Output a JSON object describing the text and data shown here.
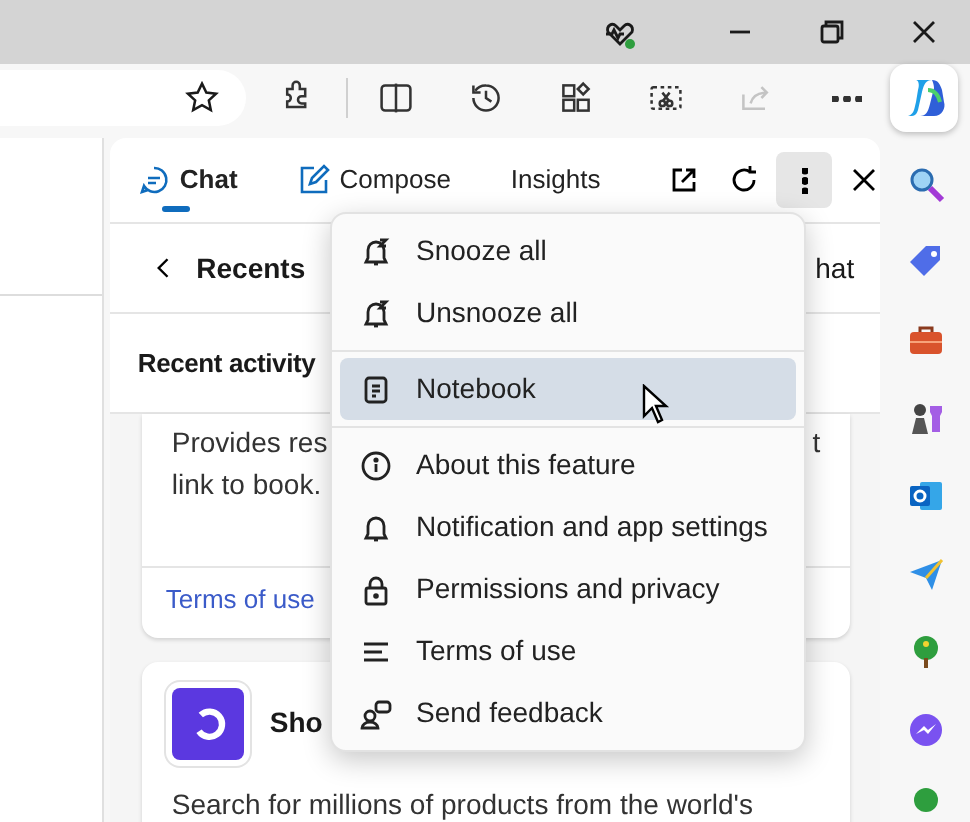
{
  "toolbar_buttons": [
    {
      "kind": "extensions",
      "disabled": false
    },
    {
      "kind": "split",
      "disabled": false
    },
    {
      "kind": "history",
      "disabled": false
    },
    {
      "kind": "collections",
      "disabled": false
    },
    {
      "kind": "screenshot",
      "disabled": false
    },
    {
      "kind": "share",
      "disabled": true
    },
    {
      "kind": "more",
      "disabled": false
    }
  ],
  "panel": {
    "tabs": [
      {
        "label": "Chat",
        "kind": "chat",
        "selected": true
      },
      {
        "label": "Compose",
        "kind": "compose",
        "selected": false
      },
      {
        "label": "Insights",
        "kind": "plain",
        "selected": false
      }
    ],
    "header_actions": [
      {
        "kind": "open",
        "active": false
      },
      {
        "kind": "refresh",
        "active": false
      },
      {
        "kind": "more",
        "active": true
      },
      {
        "kind": "close",
        "active": false
      }
    ],
    "recents": {
      "title": "Recents",
      "trailing": "hat"
    },
    "recent_activity": {
      "heading": "Recent activity"
    },
    "cards": [
      {
        "lines": [
          "Provides res",
          "link to book."
        ],
        "right_fragment": "t",
        "footer_link": "Terms of use"
      },
      {
        "title": "Sho",
        "description": "Search for millions of products from the world's"
      }
    ]
  },
  "menu": {
    "items": [
      {
        "label": "Snooze all",
        "kind": "snooze",
        "selected": false,
        "divider_after": false
      },
      {
        "label": "Unsnooze all",
        "kind": "snooze",
        "selected": false,
        "divider_after": true
      },
      {
        "label": "Notebook",
        "kind": "notebook",
        "selected": true,
        "divider_after": true
      },
      {
        "label": "About this feature",
        "kind": "info",
        "selected": false,
        "divider_after": false
      },
      {
        "label": "Notification and app settings",
        "kind": "bell",
        "selected": false,
        "divider_after": false
      },
      {
        "label": "Permissions and privacy",
        "kind": "lock",
        "selected": false,
        "divider_after": false
      },
      {
        "label": "Terms of use",
        "kind": "lines",
        "selected": false,
        "divider_after": false
      },
      {
        "label": "Send feedback",
        "kind": "feedback",
        "selected": false,
        "divider_after": false
      }
    ]
  },
  "rail": [
    {
      "kind": "search"
    },
    {
      "kind": "tag"
    },
    {
      "kind": "toolbox"
    },
    {
      "kind": "games"
    },
    {
      "kind": "outlook"
    },
    {
      "kind": "send"
    },
    {
      "kind": "tree"
    },
    {
      "kind": "messenger"
    },
    {
      "kind": "green"
    }
  ]
}
